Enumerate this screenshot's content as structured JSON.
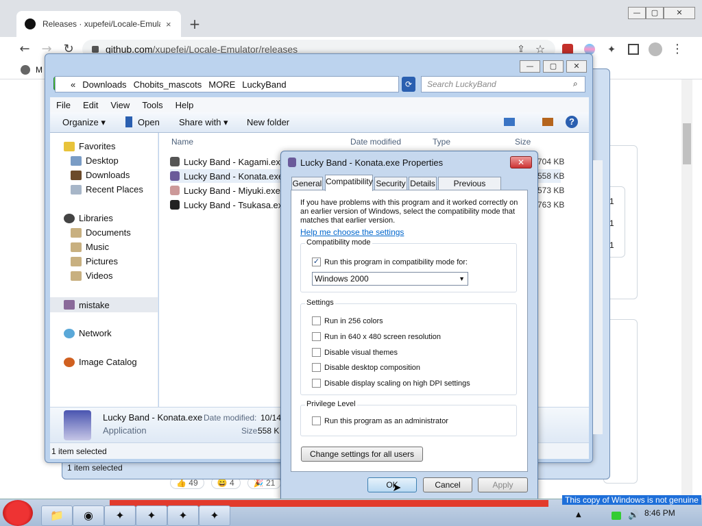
{
  "browser": {
    "tab_title": "Releases · xupefei/Locale-Emulat",
    "close_tab": "×",
    "new_tab": "+",
    "url_host": "github.com",
    "url_path": "/xupefei/Locale-Emulator/releases",
    "bookmark_label": "M",
    "min": "—",
    "max": "▢",
    "close": "✕"
  },
  "github": {
    "reactions": [
      {
        "emoji": "👍",
        "count": "49"
      },
      {
        "emoji": "😄",
        "count": "4"
      },
      {
        "emoji": "🎉",
        "count": "21"
      }
    ],
    "side_nums": [
      "1",
      "1",
      "1"
    ]
  },
  "explorer": {
    "breadcrumb": [
      "«",
      "Downloads",
      "Chobits_mascots",
      "MORE",
      "LuckyBand"
    ],
    "search_placeholder": "Search LuckyBand",
    "menu": [
      "File",
      "Edit",
      "View",
      "Tools",
      "Help"
    ],
    "commands": {
      "organize": "Organize ▾",
      "open": "Open",
      "share": "Share with ▾",
      "new_folder": "New folder"
    },
    "nav": {
      "favorites": "Favorites",
      "desktop": "Desktop",
      "downloads": "Downloads",
      "recent": "Recent Places",
      "libraries": "Libraries",
      "documents": "Documents",
      "music": "Music",
      "pictures": "Pictures",
      "videos": "Videos",
      "homegroup": "mistake",
      "network": "Network",
      "image_catalog": "Image Catalog"
    },
    "columns": {
      "name": "Name",
      "date": "Date modified",
      "type": "Type",
      "size": "Size"
    },
    "files": [
      {
        "name": "Lucky Band - Kagami.exe",
        "size": "704 KB"
      },
      {
        "name": "Lucky Band - Konata.exe",
        "size": "558 KB"
      },
      {
        "name": "Lucky Band - Miyuki.exe",
        "size": "573 KB"
      },
      {
        "name": "Lucky Band - Tsukasa.exe",
        "size": "763 KB"
      }
    ],
    "details": {
      "name": "Lucky Band - Konata.exe",
      "date_label": "Date modified:",
      "date_value": "10/14",
      "type": "Application",
      "size_label": "Size:",
      "size_value": "558 K"
    },
    "status": "1 item selected",
    "status_back": "1 item selected"
  },
  "dialog": {
    "title": "Lucky Band - Konata.exe Properties",
    "close": "✕",
    "tabs": [
      "General",
      "Compatibility",
      "Security",
      "Details",
      "Previous Versions"
    ],
    "intro": "If you have problems with this program and it worked correctly on an earlier version of Windows, select the compatibility mode that matches that earlier version.",
    "help_link": "Help me choose the settings",
    "compat_group": "Compatibility mode",
    "compat_checkbox": "Run this program in compatibility mode for:",
    "compat_checked": true,
    "compat_select": "Windows 2000",
    "settings_group": "Settings",
    "settings": [
      {
        "label": "Run in 256 colors",
        "checked": false
      },
      {
        "label": "Run in 640 x 480 screen resolution",
        "checked": false
      },
      {
        "label": "Disable visual themes",
        "checked": false
      },
      {
        "label": "Disable desktop composition",
        "checked": false
      },
      {
        "label": "Disable display scaling on high DPI settings",
        "checked": false
      }
    ],
    "privilege_group": "Privilege Level",
    "privilege_checkbox": "Run this program as an administrator",
    "change_all": "Change settings for all users",
    "ok": "OK",
    "cancel": "Cancel",
    "apply": "Apply"
  },
  "taskbar": {
    "clock": "8:46 PM",
    "notice": "This copy of Windows is not genuine"
  },
  "colors": {
    "accent": "#1e6fd9",
    "explorer_frame": "#bcd3ee",
    "dialog_frame": "#c6d8ee"
  }
}
